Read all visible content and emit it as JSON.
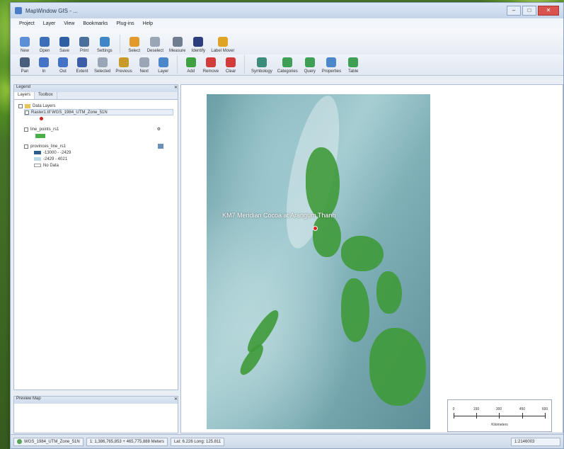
{
  "window": {
    "title": "MapWindow GIS - ..."
  },
  "menu": [
    "Project",
    "Layer",
    "View",
    "Bookmarks",
    "Plug-ins",
    "Help"
  ],
  "toolbar1": [
    {
      "label": "New",
      "color": "#5b8fd6"
    },
    {
      "label": "Open",
      "color": "#3c6fb8"
    },
    {
      "label": "Save",
      "color": "#2f5ea3"
    },
    {
      "label": "Print",
      "color": "#4b6f9b"
    },
    {
      "label": "Settings",
      "color": "#3f86c8"
    },
    {
      "label": "Select",
      "color": "#e29b2b"
    },
    {
      "label": "Deselect",
      "color": "#9aa6b5"
    },
    {
      "label": "Measure",
      "color": "#6f7d8e"
    },
    {
      "label": "Identify",
      "color": "#2c3e7c"
    },
    {
      "label": "Label Mover",
      "color": "#e0a323"
    }
  ],
  "toolbar2": [
    {
      "label": "Pan",
      "color": "#4a5f7c"
    },
    {
      "label": "In",
      "color": "#4472c4"
    },
    {
      "label": "Out",
      "color": "#4472c4"
    },
    {
      "label": "Extent",
      "color": "#3d5ea6"
    },
    {
      "label": "Selected",
      "color": "#9aa6b5"
    },
    {
      "label": "Previous",
      "color": "#c79a2a"
    },
    {
      "label": "Next",
      "color": "#9aa6b5"
    },
    {
      "label": "Layer",
      "color": "#4c88c9"
    },
    {
      "label": "Add",
      "color": "#3fa142"
    },
    {
      "label": "Remove",
      "color": "#d43b3b"
    },
    {
      "label": "Clear",
      "color": "#d43b3b"
    },
    {
      "label": "Symbology",
      "color": "#3c8c7a"
    },
    {
      "label": "Categories",
      "color": "#3f9f55"
    },
    {
      "label": "Query",
      "color": "#3f9f55"
    },
    {
      "label": "Properties",
      "color": "#4c88c9"
    },
    {
      "label": "Table",
      "color": "#3f9f55"
    }
  ],
  "legend": {
    "header": "Legend",
    "tabs": [
      "Layers",
      "Toolbox"
    ],
    "group": "Data Layers",
    "layers": [
      {
        "name": "Raster1.tif WGS_1984_UTM_Zone_51N",
        "swatch": "#cc2222"
      },
      {
        "name": "line_points_rs1",
        "swatch": "#49b04a"
      },
      {
        "name": "provinces_line_rs1",
        "swatch": "#6a8fb8"
      }
    ],
    "breaks": [
      "-13000 - -2429",
      "-2429 - 4021",
      "No Data"
    ]
  },
  "preview": {
    "header": "Preview Map"
  },
  "map": {
    "label": "KM7 Meridian Cocoa at Arangum Thanh"
  },
  "scalebar": {
    "ticks": [
      "0",
      "150",
      "300",
      "450",
      "600"
    ],
    "unit": "Kilometers"
  },
  "status": {
    "projection": "WGS_1984_UTM_Zone_51N",
    "scale": "1: 1,386,765,853 + 465,775,888 Meters",
    "coords": "Lat: 6.226 Long: 125.811",
    "zoom": "1:2146003"
  }
}
